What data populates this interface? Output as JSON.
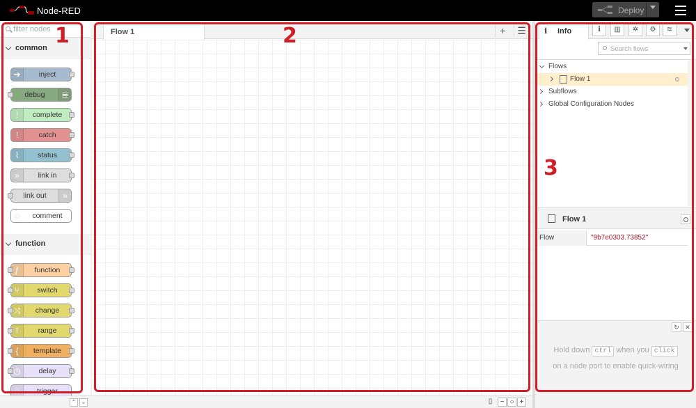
{
  "header": {
    "title": "Node-RED",
    "deploy_label": "Deploy"
  },
  "palette": {
    "filter_placeholder": "filter nodes",
    "categories": [
      {
        "label": "common",
        "nodes": [
          {
            "label": "inject",
            "color": "#a6bbcf"
          },
          {
            "label": "debug",
            "color": "#87a980"
          },
          {
            "label": "complete",
            "color": "#c0edc0"
          },
          {
            "label": "catch",
            "color": "#e49191"
          },
          {
            "label": "status",
            "color": "#94c1d0"
          },
          {
            "label": "link in",
            "color": "#dddddd"
          },
          {
            "label": "link out",
            "color": "#dddddd"
          },
          {
            "label": "comment",
            "color": "#ffffff"
          }
        ]
      },
      {
        "label": "function",
        "nodes": [
          {
            "label": "function",
            "color": "#fdd0a2"
          },
          {
            "label": "switch",
            "color": "#e2d96e"
          },
          {
            "label": "change",
            "color": "#e2d96e"
          },
          {
            "label": "range",
            "color": "#e2d96e"
          },
          {
            "label": "template",
            "color": "#f0b05f"
          },
          {
            "label": "delay",
            "color": "#e6e0f8"
          },
          {
            "label": "trigger",
            "color": "#e6e0f8"
          }
        ]
      }
    ]
  },
  "workspace": {
    "tabs": [
      {
        "label": "Flow 1"
      }
    ]
  },
  "sidebar": {
    "active_tab": "info",
    "search_placeholder": "Search flows",
    "tree": {
      "flows_label": "Flows",
      "flow_item": "Flow 1",
      "subflows_label": "Subflows",
      "global_config_label": "Global Configuration Nodes"
    },
    "properties": {
      "title": "Flow 1",
      "key": "Flow",
      "value": "\"9b7e0303.73852\""
    },
    "help": {
      "line1_pre": "Hold down",
      "key1": "ctrl",
      "line1_mid": "when you",
      "key2": "click",
      "line2": "on a node port to enable quick-wiring"
    }
  },
  "annotations": {
    "palette_number": "1",
    "workspace_number": "2",
    "sidebar_number": "3",
    "color": "#d11f2a"
  }
}
